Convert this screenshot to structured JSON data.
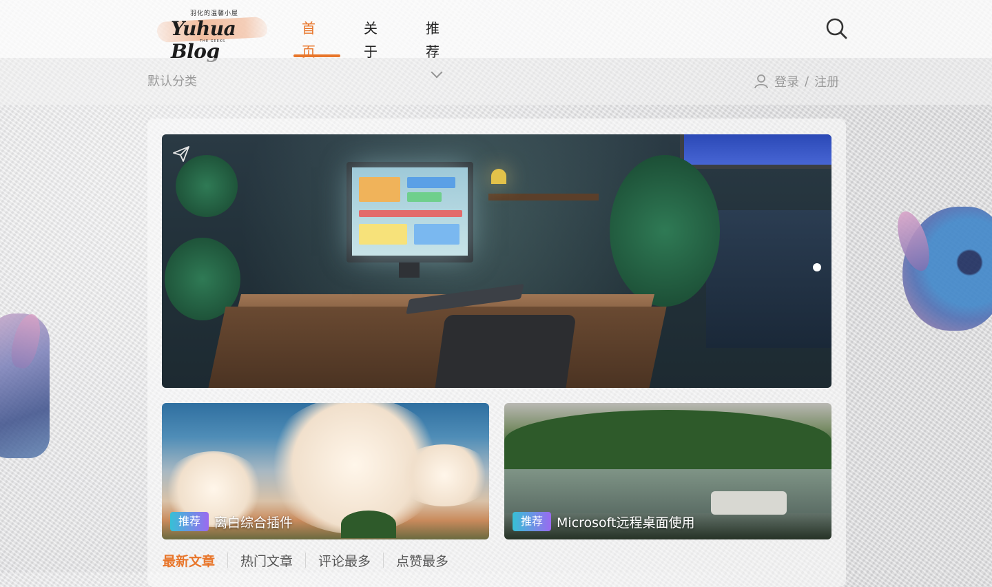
{
  "colors": {
    "accent": "#e8762b",
    "tag_gradient_start": "#36c0d6",
    "tag_gradient_end": "#9a6af0",
    "muted_text": "#9a9a9a"
  },
  "header": {
    "logo": {
      "small_text": "羽化的温馨小屋",
      "main_text": "Yuhua Blog",
      "tagline": "THE GEEKS"
    },
    "nav": [
      {
        "label": "首页",
        "active": true
      },
      {
        "label": "关于",
        "active": false
      },
      {
        "label": "推荐",
        "active": false,
        "has_dropdown": true
      }
    ],
    "search_icon": "search-icon"
  },
  "subbar": {
    "breadcrumb": "默认分类",
    "user_icon": "user-icon",
    "login": "登录",
    "separator": "/",
    "register": "注册"
  },
  "hero": {
    "send_icon": "paper-plane-icon",
    "carousel_dots": 1
  },
  "cards": [
    {
      "tag": "推荐",
      "title": "离白综合插件"
    },
    {
      "tag": "推荐",
      "title": "Microsoft远程桌面使用"
    }
  ],
  "tabs": [
    {
      "label": "最新文章",
      "active": true
    },
    {
      "label": "热门文章",
      "active": false
    },
    {
      "label": "评论最多",
      "active": false
    },
    {
      "label": "点赞最多",
      "active": false
    }
  ]
}
